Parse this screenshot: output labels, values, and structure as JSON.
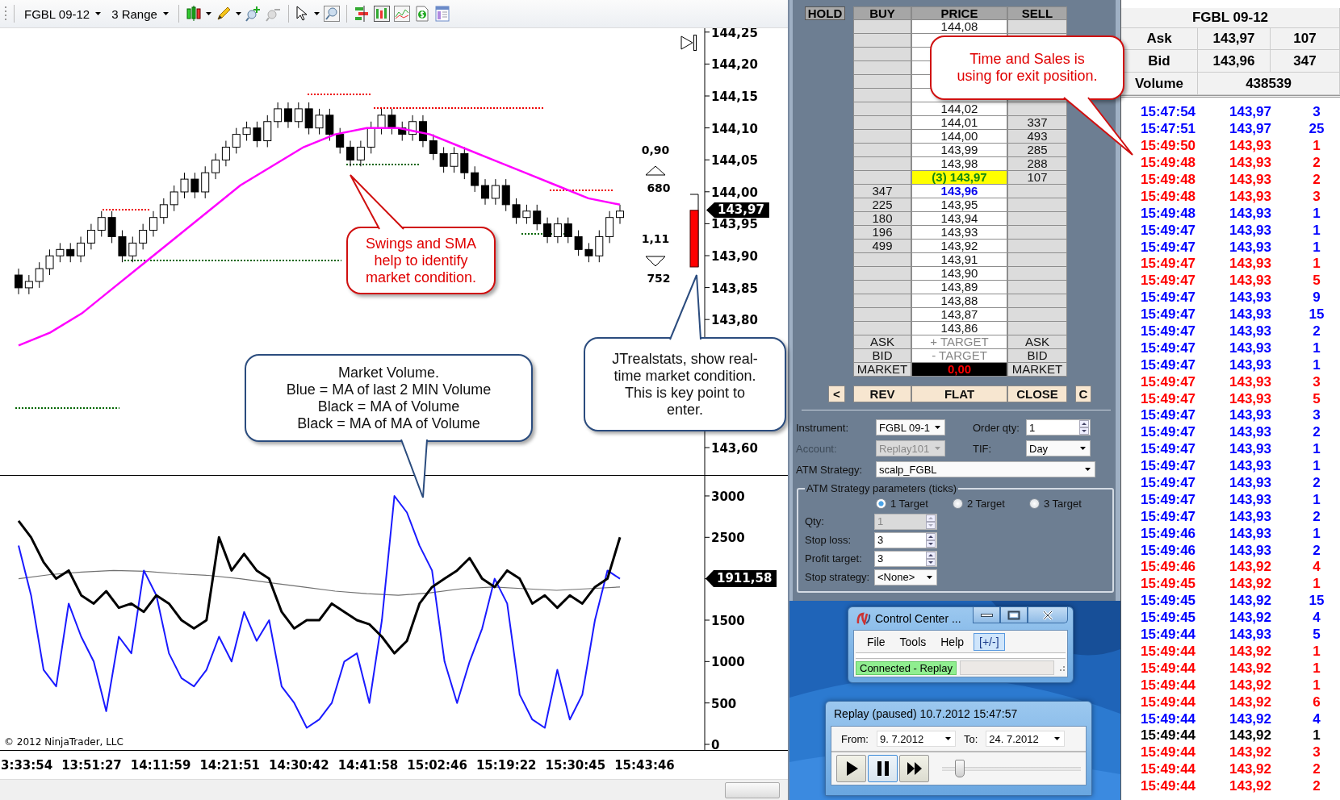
{
  "chart_window": {
    "toolbar": {
      "instrument": "FGBL 09-12",
      "bar_type": "3 Range"
    },
    "price_panel": {
      "axis_labels": [
        "144,25",
        "144,20",
        "144,15",
        "144,10",
        "144,05",
        "144,00",
        "143,95",
        "143,90",
        "143,85",
        "143,80",
        "143,60"
      ],
      "last_price": "143,97",
      "stats": [
        {
          "kind": "up",
          "value": "0,90",
          "count": "680"
        },
        {
          "kind": "down",
          "value": "1,11",
          "count": "752"
        }
      ],
      "strength_meter": {
        "level": 0.78
      }
    },
    "volume_panel": {
      "axis_labels": [
        "3000",
        "2500",
        "1500",
        "1000",
        "500",
        "0"
      ],
      "last_value": "1911,58",
      "copyright": "© 2012 NinjaTrader, LLC"
    },
    "time_axis": [
      "3:33:54",
      "13:51:27",
      "14:11:59",
      "14:21:51",
      "14:30:42",
      "14:41:58",
      "15:02:46",
      "15:19:22",
      "15:30:45",
      "15:43:46"
    ]
  },
  "callouts": [
    {
      "kind": "red",
      "lines": [
        "Swings and SMA",
        "help to identify",
        "market condition."
      ]
    },
    {
      "kind": "blue",
      "lines": [
        "Market Volume.",
        "Blue = MA of last 2 MIN Volume",
        "Black = MA of Volume",
        "Black = MA of MA of Volume"
      ]
    },
    {
      "kind": "blue",
      "lines": [
        "JTrealstats, show real-",
        "time market condition.",
        "This is key point to",
        "enter."
      ]
    },
    {
      "kind": "red",
      "lines": [
        "Time and Sales is",
        "using for exit position."
      ]
    }
  ],
  "dom": {
    "headers": [
      "HOLD",
      "BUY",
      "PRICE",
      "SELL"
    ],
    "rows": [
      {
        "kind": "plain",
        "price": "144,08"
      },
      {
        "kind": "plain"
      },
      {
        "kind": "plain"
      },
      {
        "kind": "plain"
      },
      {
        "kind": "plain"
      },
      {
        "kind": "plain"
      },
      {
        "kind": "plain",
        "price": "144,02"
      },
      {
        "kind": "plain",
        "price": "144,01",
        "sell": "337"
      },
      {
        "kind": "plain",
        "price": "144,00",
        "sell": "493"
      },
      {
        "kind": "plain",
        "price": "143,99",
        "sell": "285"
      },
      {
        "kind": "plain",
        "price": "143,98",
        "sell": "288"
      },
      {
        "kind": "ask",
        "price": "(3) 143,97",
        "sell": "107"
      },
      {
        "kind": "bid",
        "price": "143,96",
        "buy": "347"
      },
      {
        "kind": "plain",
        "price": "143,95",
        "buy": "225"
      },
      {
        "kind": "plain",
        "price": "143,94",
        "buy": "180"
      },
      {
        "kind": "plain",
        "price": "143,93",
        "buy": "196"
      },
      {
        "kind": "plain",
        "price": "143,92",
        "buy": "499"
      },
      {
        "kind": "plain",
        "price": "143,91"
      },
      {
        "kind": "plain",
        "price": "143,90"
      },
      {
        "kind": "plain",
        "price": "143,89"
      },
      {
        "kind": "plain",
        "price": "143,88"
      },
      {
        "kind": "plain",
        "price": "143,87"
      },
      {
        "kind": "plain",
        "price": "143,86"
      }
    ],
    "footer_rows": [
      {
        "kind": "target",
        "buy": "ASK",
        "price": "+ TARGET",
        "sell": "ASK"
      },
      {
        "kind": "target",
        "buy": "BID",
        "price": "- TARGET",
        "sell": "BID"
      },
      {
        "kind": "market",
        "buy": "MARKET",
        "price": "0,00",
        "sell": "MARKET"
      }
    ],
    "buttons": [
      "<",
      "REV",
      "FLAT",
      "CLOSE",
      "C"
    ]
  },
  "order_entry": {
    "instrument": {
      "label": "Instrument:",
      "value": "FGBL 09-1"
    },
    "order_qty": {
      "label": "Order qty:",
      "value": "1"
    },
    "account": {
      "label": "Account:",
      "value": "Replay101",
      "disabled": true
    },
    "tif": {
      "label": "TIF:",
      "value": "Day"
    },
    "atm_strategy": {
      "label": "ATM Strategy:",
      "value": "scalp_FGBL"
    },
    "parameters": {
      "title": "ATM Strategy parameters (ticks)",
      "targets": [
        {
          "label": "1 Target",
          "selected": true
        },
        {
          "label": "2 Target",
          "selected": false
        },
        {
          "label": "3 Target",
          "selected": false
        }
      ],
      "fields": [
        {
          "kind": "spin",
          "label": "Qty:",
          "value": "1",
          "disabled": true
        },
        {
          "kind": "spin",
          "label": "Stop loss:",
          "value": "3",
          "disabled": false
        },
        {
          "kind": "spin",
          "label": "Profit target:",
          "value": "3",
          "disabled": false
        },
        {
          "kind": "select",
          "label": "Stop strategy:",
          "value": "<None>",
          "disabled": false
        }
      ]
    }
  },
  "control_center": {
    "title": "Control Center ...",
    "menu": [
      {
        "label": "File",
        "selected": false
      },
      {
        "label": "Tools",
        "selected": false
      },
      {
        "label": "Help",
        "selected": false
      },
      {
        "label": "[+/-]",
        "selected": true
      }
    ],
    "status": "Connected - Replay"
  },
  "replay": {
    "title": "Replay (paused) 10.7.2012 15:47:57",
    "from_label": "From:",
    "from": "9.  7.2012",
    "to_label": "To:",
    "to": "24.  7.2012",
    "controls": [
      {
        "kind": "play",
        "selected": false
      },
      {
        "kind": "pause",
        "selected": true
      },
      {
        "kind": "forward",
        "selected": false
      }
    ],
    "position": {
      "level": 0.12
    }
  },
  "time_and_sales": {
    "instrument": "FGBL 09-12",
    "quotes": [
      {
        "label": "Ask",
        "price": "143,97",
        "size": "107"
      },
      {
        "label": "Bid",
        "price": "143,96",
        "size": "347"
      }
    ],
    "volume_label": "Volume",
    "volume": "438539",
    "trades": [
      {
        "time": "15:47:54",
        "price": "143,97",
        "size": "3",
        "color": "#0000ff"
      },
      {
        "time": "15:47:51",
        "price": "143,97",
        "size": "25",
        "color": "#0000ff"
      },
      {
        "time": "15:49:50",
        "price": "143,93",
        "size": "1",
        "color": "#ff0000"
      },
      {
        "time": "15:49:48",
        "price": "143,93",
        "size": "2",
        "color": "#ff0000"
      },
      {
        "time": "15:49:48",
        "price": "143,93",
        "size": "2",
        "color": "#ff0000"
      },
      {
        "time": "15:49:48",
        "price": "143,93",
        "size": "3",
        "color": "#ff0000"
      },
      {
        "time": "15:49:48",
        "price": "143,93",
        "size": "1",
        "color": "#0000ff"
      },
      {
        "time": "15:49:47",
        "price": "143,93",
        "size": "1",
        "color": "#0000ff"
      },
      {
        "time": "15:49:47",
        "price": "143,93",
        "size": "1",
        "color": "#0000ff"
      },
      {
        "time": "15:49:47",
        "price": "143,93",
        "size": "1",
        "color": "#ff0000"
      },
      {
        "time": "15:49:47",
        "price": "143,93",
        "size": "5",
        "color": "#ff0000"
      },
      {
        "time": "15:49:47",
        "price": "143,93",
        "size": "9",
        "color": "#0000ff"
      },
      {
        "time": "15:49:47",
        "price": "143,93",
        "size": "15",
        "color": "#0000ff"
      },
      {
        "time": "15:49:47",
        "price": "143,93",
        "size": "2",
        "color": "#0000ff"
      },
      {
        "time": "15:49:47",
        "price": "143,93",
        "size": "1",
        "color": "#0000ff"
      },
      {
        "time": "15:49:47",
        "price": "143,93",
        "size": "1",
        "color": "#0000ff"
      },
      {
        "time": "15:49:47",
        "price": "143,93",
        "size": "3",
        "color": "#ff0000"
      },
      {
        "time": "15:49:47",
        "price": "143,93",
        "size": "5",
        "color": "#ff0000"
      },
      {
        "time": "15:49:47",
        "price": "143,93",
        "size": "3",
        "color": "#0000ff"
      },
      {
        "time": "15:49:47",
        "price": "143,93",
        "size": "2",
        "color": "#0000ff"
      },
      {
        "time": "15:49:47",
        "price": "143,93",
        "size": "1",
        "color": "#0000ff"
      },
      {
        "time": "15:49:47",
        "price": "143,93",
        "size": "1",
        "color": "#0000ff"
      },
      {
        "time": "15:49:47",
        "price": "143,93",
        "size": "2",
        "color": "#0000ff"
      },
      {
        "time": "15:49:47",
        "price": "143,93",
        "size": "1",
        "color": "#0000ff"
      },
      {
        "time": "15:49:47",
        "price": "143,93",
        "size": "2",
        "color": "#0000ff"
      },
      {
        "time": "15:49:46",
        "price": "143,93",
        "size": "1",
        "color": "#0000ff"
      },
      {
        "time": "15:49:46",
        "price": "143,93",
        "size": "2",
        "color": "#0000ff"
      },
      {
        "time": "15:49:46",
        "price": "143,92",
        "size": "4",
        "color": "#ff0000"
      },
      {
        "time": "15:49:45",
        "price": "143,92",
        "size": "1",
        "color": "#ff0000"
      },
      {
        "time": "15:49:45",
        "price": "143,92",
        "size": "15",
        "color": "#0000ff"
      },
      {
        "time": "15:49:45",
        "price": "143,92",
        "size": "4",
        "color": "#0000ff"
      },
      {
        "time": "15:49:44",
        "price": "143,93",
        "size": "5",
        "color": "#0000ff"
      },
      {
        "time": "15:49:44",
        "price": "143,92",
        "size": "1",
        "color": "#ff0000"
      },
      {
        "time": "15:49:44",
        "price": "143,92",
        "size": "1",
        "color": "#ff0000"
      },
      {
        "time": "15:49:44",
        "price": "143,92",
        "size": "1",
        "color": "#ff0000"
      },
      {
        "time": "15:49:44",
        "price": "143,92",
        "size": "6",
        "color": "#ff0000"
      },
      {
        "time": "15:49:44",
        "price": "143,92",
        "size": "4",
        "color": "#0000ff"
      },
      {
        "time": "15:49:44",
        "price": "143,92",
        "size": "1",
        "color": "#000000"
      },
      {
        "time": "15:49:44",
        "price": "143,92",
        "size": "3",
        "color": "#ff0000"
      },
      {
        "time": "15:49:44",
        "price": "143,92",
        "size": "2",
        "color": "#ff0000"
      },
      {
        "time": "15:49:44",
        "price": "143,92",
        "size": "2",
        "color": "#ff0000"
      }
    ]
  }
}
